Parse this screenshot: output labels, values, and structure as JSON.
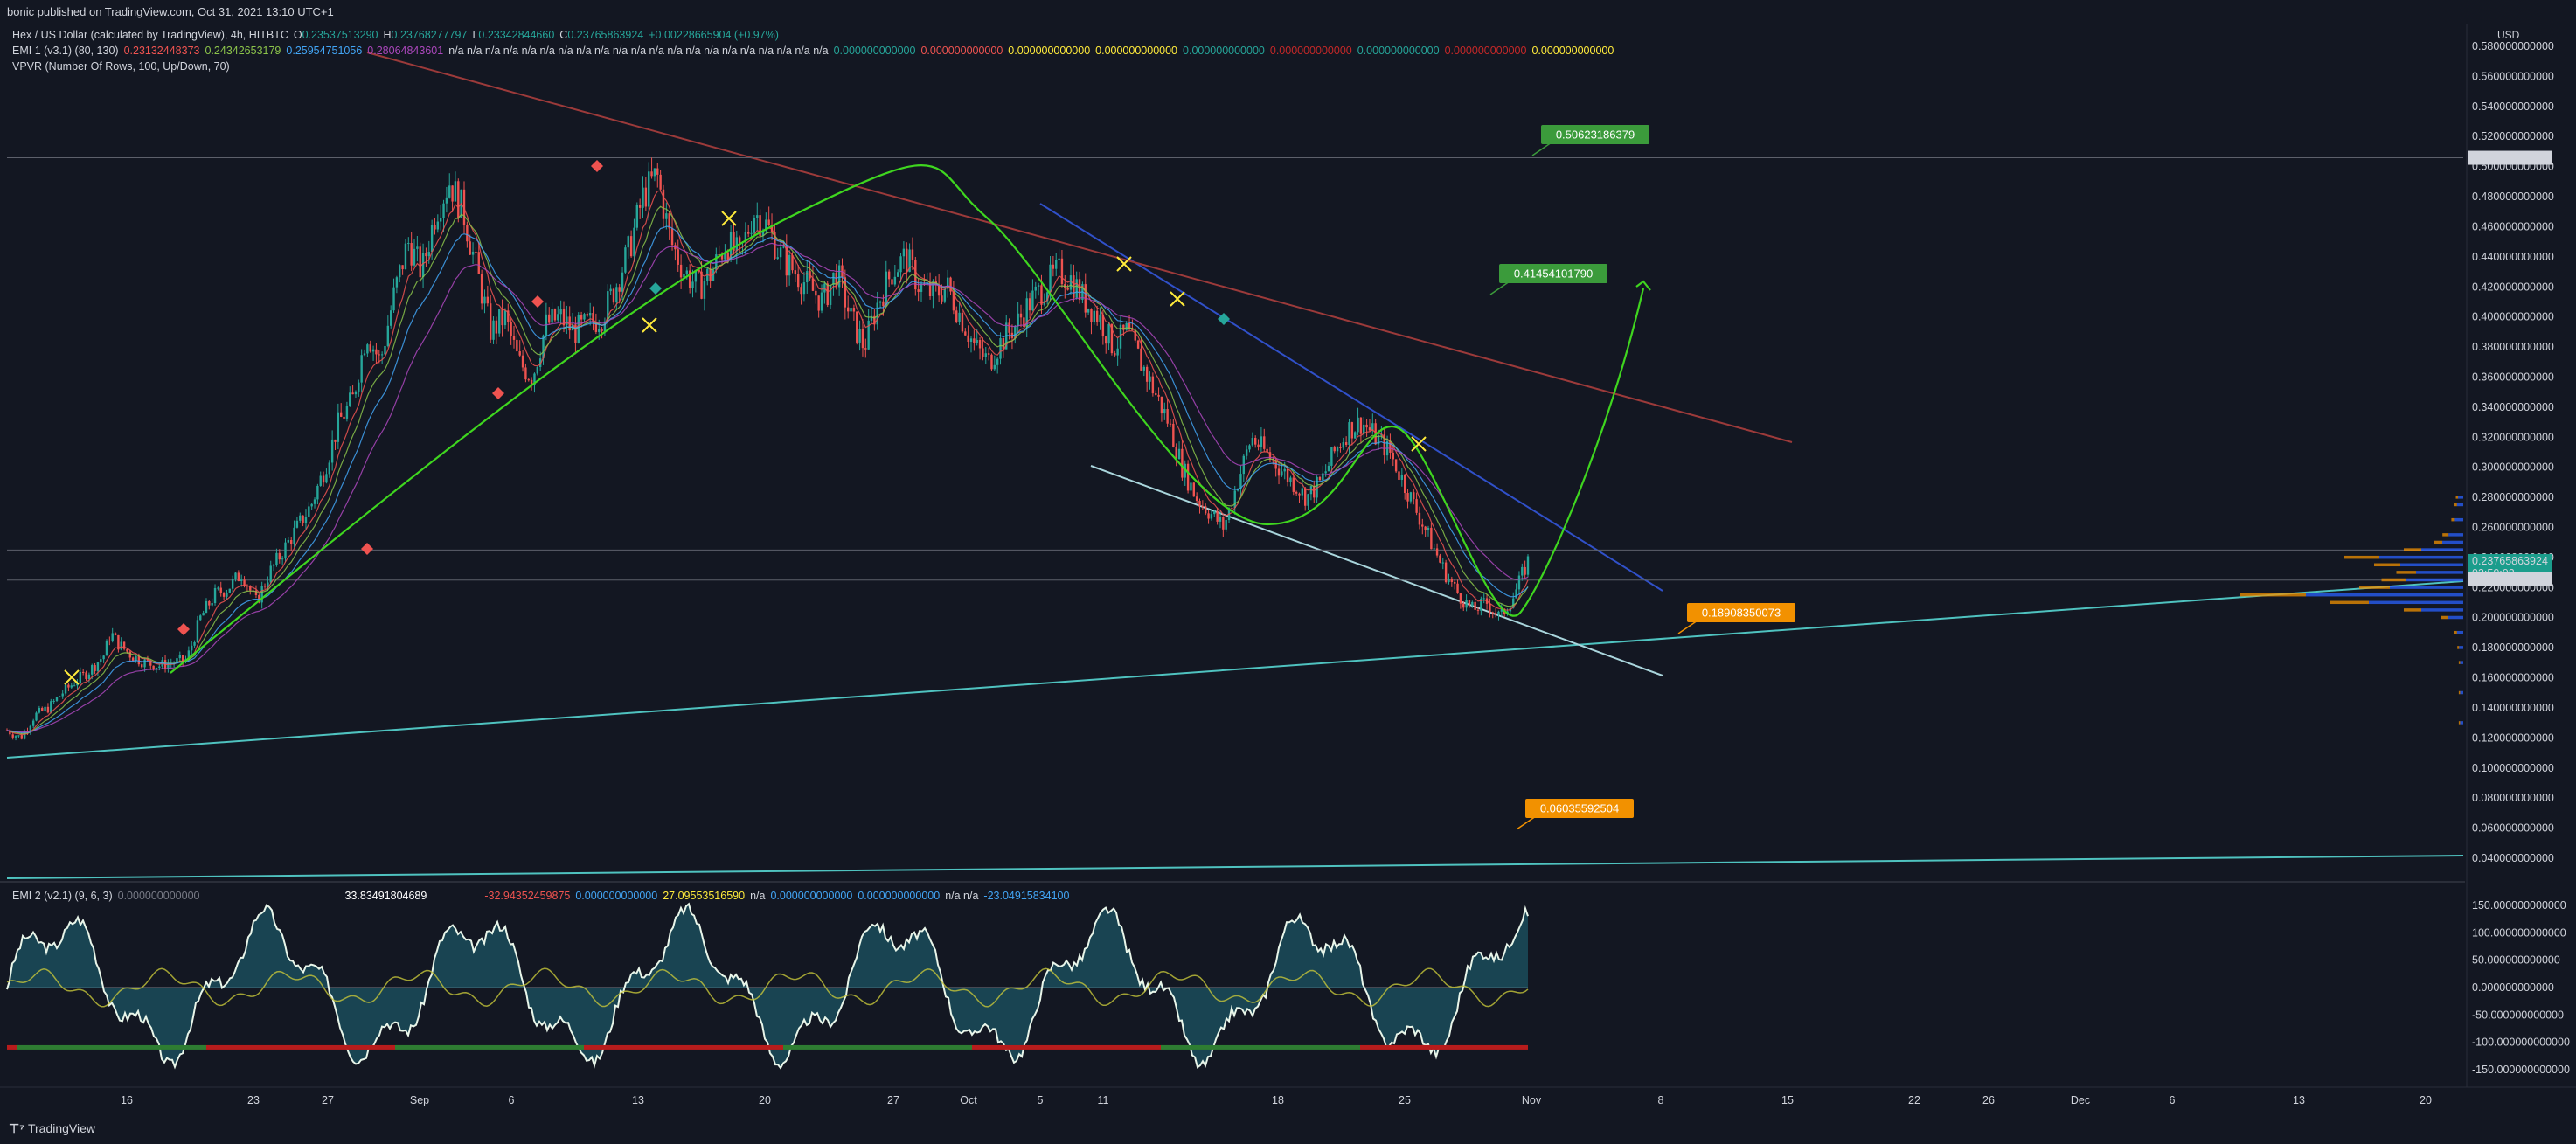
{
  "header": {
    "published": "bonic published on TradingView.com, Oct 31, 2021 13:10 UTC+1",
    "symbol": "Hex / US Dollar (calculated by TradingView), 4h, HITBTC",
    "o_label": "O",
    "o": "0.23537513290",
    "h_label": "H",
    "h": "0.23768277797",
    "l_label": "L",
    "l": "0.23342844660",
    "c_label": "C",
    "c": "0.23765863924",
    "chg": "+0.00228665904 (+0.97%)",
    "ema1_name": "EMI 1 (v3.1) (80, 130)",
    "ema1_v1": "0.23132448373",
    "ema1_v2": "0.24342653179",
    "ema1_v3": "0.25954751056",
    "ema1_v4": "0.28064843601",
    "ema1_na": "n/a n/a n/a n/a n/a n/a n/a n/a n/a n/a n/a n/a n/a n/a n/a n/a n/a n/a n/a n/a n/a",
    "ema1_z1": "0.000000000000",
    "ema1_z2": "0.000000000000",
    "ema1_z3": "0.000000000000",
    "ema1_z4": "0.000000000000",
    "ema1_z5": "0.000000000000",
    "ema1_z6": "0.000000000000",
    "ema1_z7": "0.000000000000",
    "ema1_z8": "0.000000000000",
    "ema1_z9": "0.000000000000",
    "vpvr": "VPVR (Number Of Rows, 100, Up/Down, 70)",
    "ema2_name": "EMI 2 (v2.1) (9, 6, 3)",
    "ema2_v1": "0.000000000000",
    "ema2_v2": "33.83491804689",
    "ema2_v3": "-32.94352459875",
    "ema2_v4": "0.000000000000",
    "ema2_v5": "27.09553516590",
    "ema2_na1": "n/a",
    "ema2_v6": "0.000000000000",
    "ema2_v7": "0.000000000000",
    "ema2_na2": "n/a n/a",
    "ema2_v8": "-23.04915834100"
  },
  "footer": {
    "brand": "TradingView"
  },
  "currency": "USD",
  "colors": {
    "bg": "#131722",
    "green_candle": "#26a69a",
    "red_candle": "#ef5350",
    "projection": "#3fd61f",
    "wedge_upper": "#3050c8",
    "downtrend": "#9c3a3a",
    "support": "#4fc3c0",
    "tag_green": "#3b9b3b",
    "tag_orange": "#f29100",
    "price_tag": "#1b9d8c"
  },
  "chart_data": [
    {
      "type": "candlestick",
      "title": "Hex / US Dollar (calculated by TradingView), 4h, HITBTC",
      "x_ticks": [
        "16",
        "23",
        "27",
        "Sep",
        "6",
        "13",
        "20",
        "27",
        "Oct",
        "5",
        "11",
        "18",
        "25",
        "Nov",
        "8",
        "15",
        "22",
        "26",
        "Dec",
        "6",
        "13",
        "20"
      ],
      "y_ticks": [
        "0.580000000000",
        "0.560000000000",
        "0.540000000000",
        "0.520000000000",
        "0.500000000000",
        "0.480000000000",
        "0.460000000000",
        "0.440000000000",
        "0.420000000000",
        "0.400000000000",
        "0.380000000000",
        "0.360000000000",
        "0.340000000000",
        "0.320000000000",
        "0.300000000000",
        "0.280000000000",
        "0.260000000000",
        "0.240000000000",
        "0.220000000000",
        "0.200000000000",
        "0.180000000000",
        "0.160000000000",
        "0.140000000000",
        "0.120000000000",
        "0.100000000000",
        "0.080000000000",
        "0.060000000000",
        "0.040000000000"
      ],
      "ylim": [
        0.03,
        0.59
      ],
      "price_path": [
        [
          0,
          0.125
        ],
        [
          1,
          0.12
        ],
        [
          2,
          0.135
        ],
        [
          3,
          0.14
        ],
        [
          4,
          0.15
        ],
        [
          5,
          0.158
        ],
        [
          6,
          0.165
        ],
        [
          7,
          0.175
        ],
        [
          7.5,
          0.19
        ],
        [
          8,
          0.183
        ],
        [
          9,
          0.175
        ],
        [
          10,
          0.17
        ],
        [
          11,
          0.168
        ],
        [
          12,
          0.17
        ],
        [
          13,
          0.172
        ],
        [
          14,
          0.2
        ],
        [
          15,
          0.215
        ],
        [
          16,
          0.22
        ],
        [
          17,
          0.23
        ],
        [
          18,
          0.21
        ],
        [
          19,
          0.23
        ],
        [
          20,
          0.245
        ],
        [
          21,
          0.26
        ],
        [
          22,
          0.275
        ],
        [
          23,
          0.3
        ],
        [
          24,
          0.33
        ],
        [
          25,
          0.345
        ],
        [
          26,
          0.39
        ],
        [
          27,
          0.37
        ],
        [
          28,
          0.415
        ],
        [
          29,
          0.45
        ],
        [
          30,
          0.43
        ],
        [
          31,
          0.47
        ],
        [
          32,
          0.49
        ],
        [
          33,
          0.47
        ],
        [
          34,
          0.43
        ],
        [
          35,
          0.39
        ],
        [
          36,
          0.4
        ],
        [
          37,
          0.37
        ],
        [
          38,
          0.36
        ],
        [
          39,
          0.395
        ],
        [
          40,
          0.4
        ],
        [
          41,
          0.39
        ],
        [
          42,
          0.395
        ],
        [
          43,
          0.4
        ],
        [
          44,
          0.42
        ],
        [
          45,
          0.445
        ],
        [
          46,
          0.48
        ],
        [
          47,
          0.495
        ],
        [
          48,
          0.45
        ],
        [
          49,
          0.43
        ],
        [
          50,
          0.42
        ],
        [
          51,
          0.43
        ],
        [
          52,
          0.45
        ],
        [
          53,
          0.44
        ],
        [
          54,
          0.47
        ],
        [
          55,
          0.46
        ],
        [
          56,
          0.44
        ],
        [
          57,
          0.43
        ],
        [
          58,
          0.42
        ],
        [
          59,
          0.41
        ],
        [
          60,
          0.43
        ],
        [
          61,
          0.4
        ],
        [
          62,
          0.38
        ],
        [
          63,
          0.41
        ],
        [
          64,
          0.43
        ],
        [
          65,
          0.44
        ],
        [
          66,
          0.42
        ],
        [
          67,
          0.415
        ],
        [
          68,
          0.42
        ],
        [
          69,
          0.4
        ],
        [
          70,
          0.38
        ],
        [
          71,
          0.37
        ],
        [
          72,
          0.385
        ],
        [
          73,
          0.395
        ],
        [
          74,
          0.41
        ],
        [
          75,
          0.42
        ],
        [
          76,
          0.43
        ],
        [
          77,
          0.425
        ],
        [
          78,
          0.41
        ],
        [
          79,
          0.4
        ],
        [
          80,
          0.38
        ],
        [
          81,
          0.39
        ],
        [
          82,
          0.37
        ],
        [
          83,
          0.35
        ],
        [
          84,
          0.33
        ],
        [
          85,
          0.3
        ],
        [
          86,
          0.28
        ],
        [
          87,
          0.27
        ],
        [
          88,
          0.26
        ],
        [
          89,
          0.29
        ],
        [
          90,
          0.32
        ],
        [
          91,
          0.31
        ],
        [
          92,
          0.3
        ],
        [
          93,
          0.29
        ],
        [
          94,
          0.28
        ],
        [
          95,
          0.29
        ],
        [
          96,
          0.31
        ],
        [
          97,
          0.325
        ],
        [
          98,
          0.33
        ],
        [
          99,
          0.32
        ],
        [
          100,
          0.31
        ],
        [
          101,
          0.29
        ],
        [
          102,
          0.27
        ],
        [
          103,
          0.25
        ],
        [
          104,
          0.23
        ],
        [
          105,
          0.215
        ],
        [
          106,
          0.205
        ],
        [
          107,
          0.21
        ],
        [
          108,
          0.2
        ],
        [
          109,
          0.215
        ],
        [
          110,
          0.2377
        ]
      ],
      "levels": [
        {
          "label": "0.50623186379",
          "color": "tag_green"
        },
        {
          "label": "0.41454101790",
          "color": "tag_green"
        },
        {
          "label": "0.18908350073",
          "color": "tag_orange"
        },
        {
          "label": "0.06035592504",
          "color": "tag_orange"
        }
      ],
      "horizontal_line": {
        "value": 0.50586518799,
        "label": "0.505865187 99"
      },
      "last_price": {
        "value": 0.23765863924,
        "label": "0.23765863924",
        "timer": "03:50:02"
      },
      "ref_price": {
        "value": 0.22545793938,
        "label": "0.22545793938"
      },
      "vpvr_rows": [
        {
          "value": 0.28,
          "len": 5
        },
        {
          "value": 0.275,
          "len": 6
        },
        {
          "value": 0.265,
          "len": 8
        },
        {
          "value": 0.255,
          "len": 14
        },
        {
          "value": 0.25,
          "len": 20
        },
        {
          "value": 0.245,
          "len": 40
        },
        {
          "value": 0.24,
          "len": 80
        },
        {
          "value": 0.235,
          "len": 60
        },
        {
          "value": 0.23,
          "len": 45
        },
        {
          "value": 0.225,
          "len": 55
        },
        {
          "value": 0.22,
          "len": 70
        },
        {
          "value": 0.215,
          "len": 150
        },
        {
          "value": 0.21,
          "len": 90
        },
        {
          "value": 0.205,
          "len": 40
        },
        {
          "value": 0.2,
          "len": 15
        },
        {
          "value": 0.19,
          "len": 6
        },
        {
          "value": 0.18,
          "len": 4
        },
        {
          "value": 0.17,
          "len": 3
        },
        {
          "value": 0.15,
          "len": 3
        },
        {
          "value": 0.13,
          "len": 3
        }
      ]
    },
    {
      "type": "oscillator",
      "title": "EMI 2 (v2.1) (9, 6, 3)",
      "y_ticks": [
        "150.000000000000",
        "100.000000000000",
        "50.000000000000",
        "0.000000000000",
        "-50.000000000000",
        "-100.000000000000",
        "-150.000000000000"
      ],
      "ylim": [
        -170,
        170
      ]
    }
  ]
}
